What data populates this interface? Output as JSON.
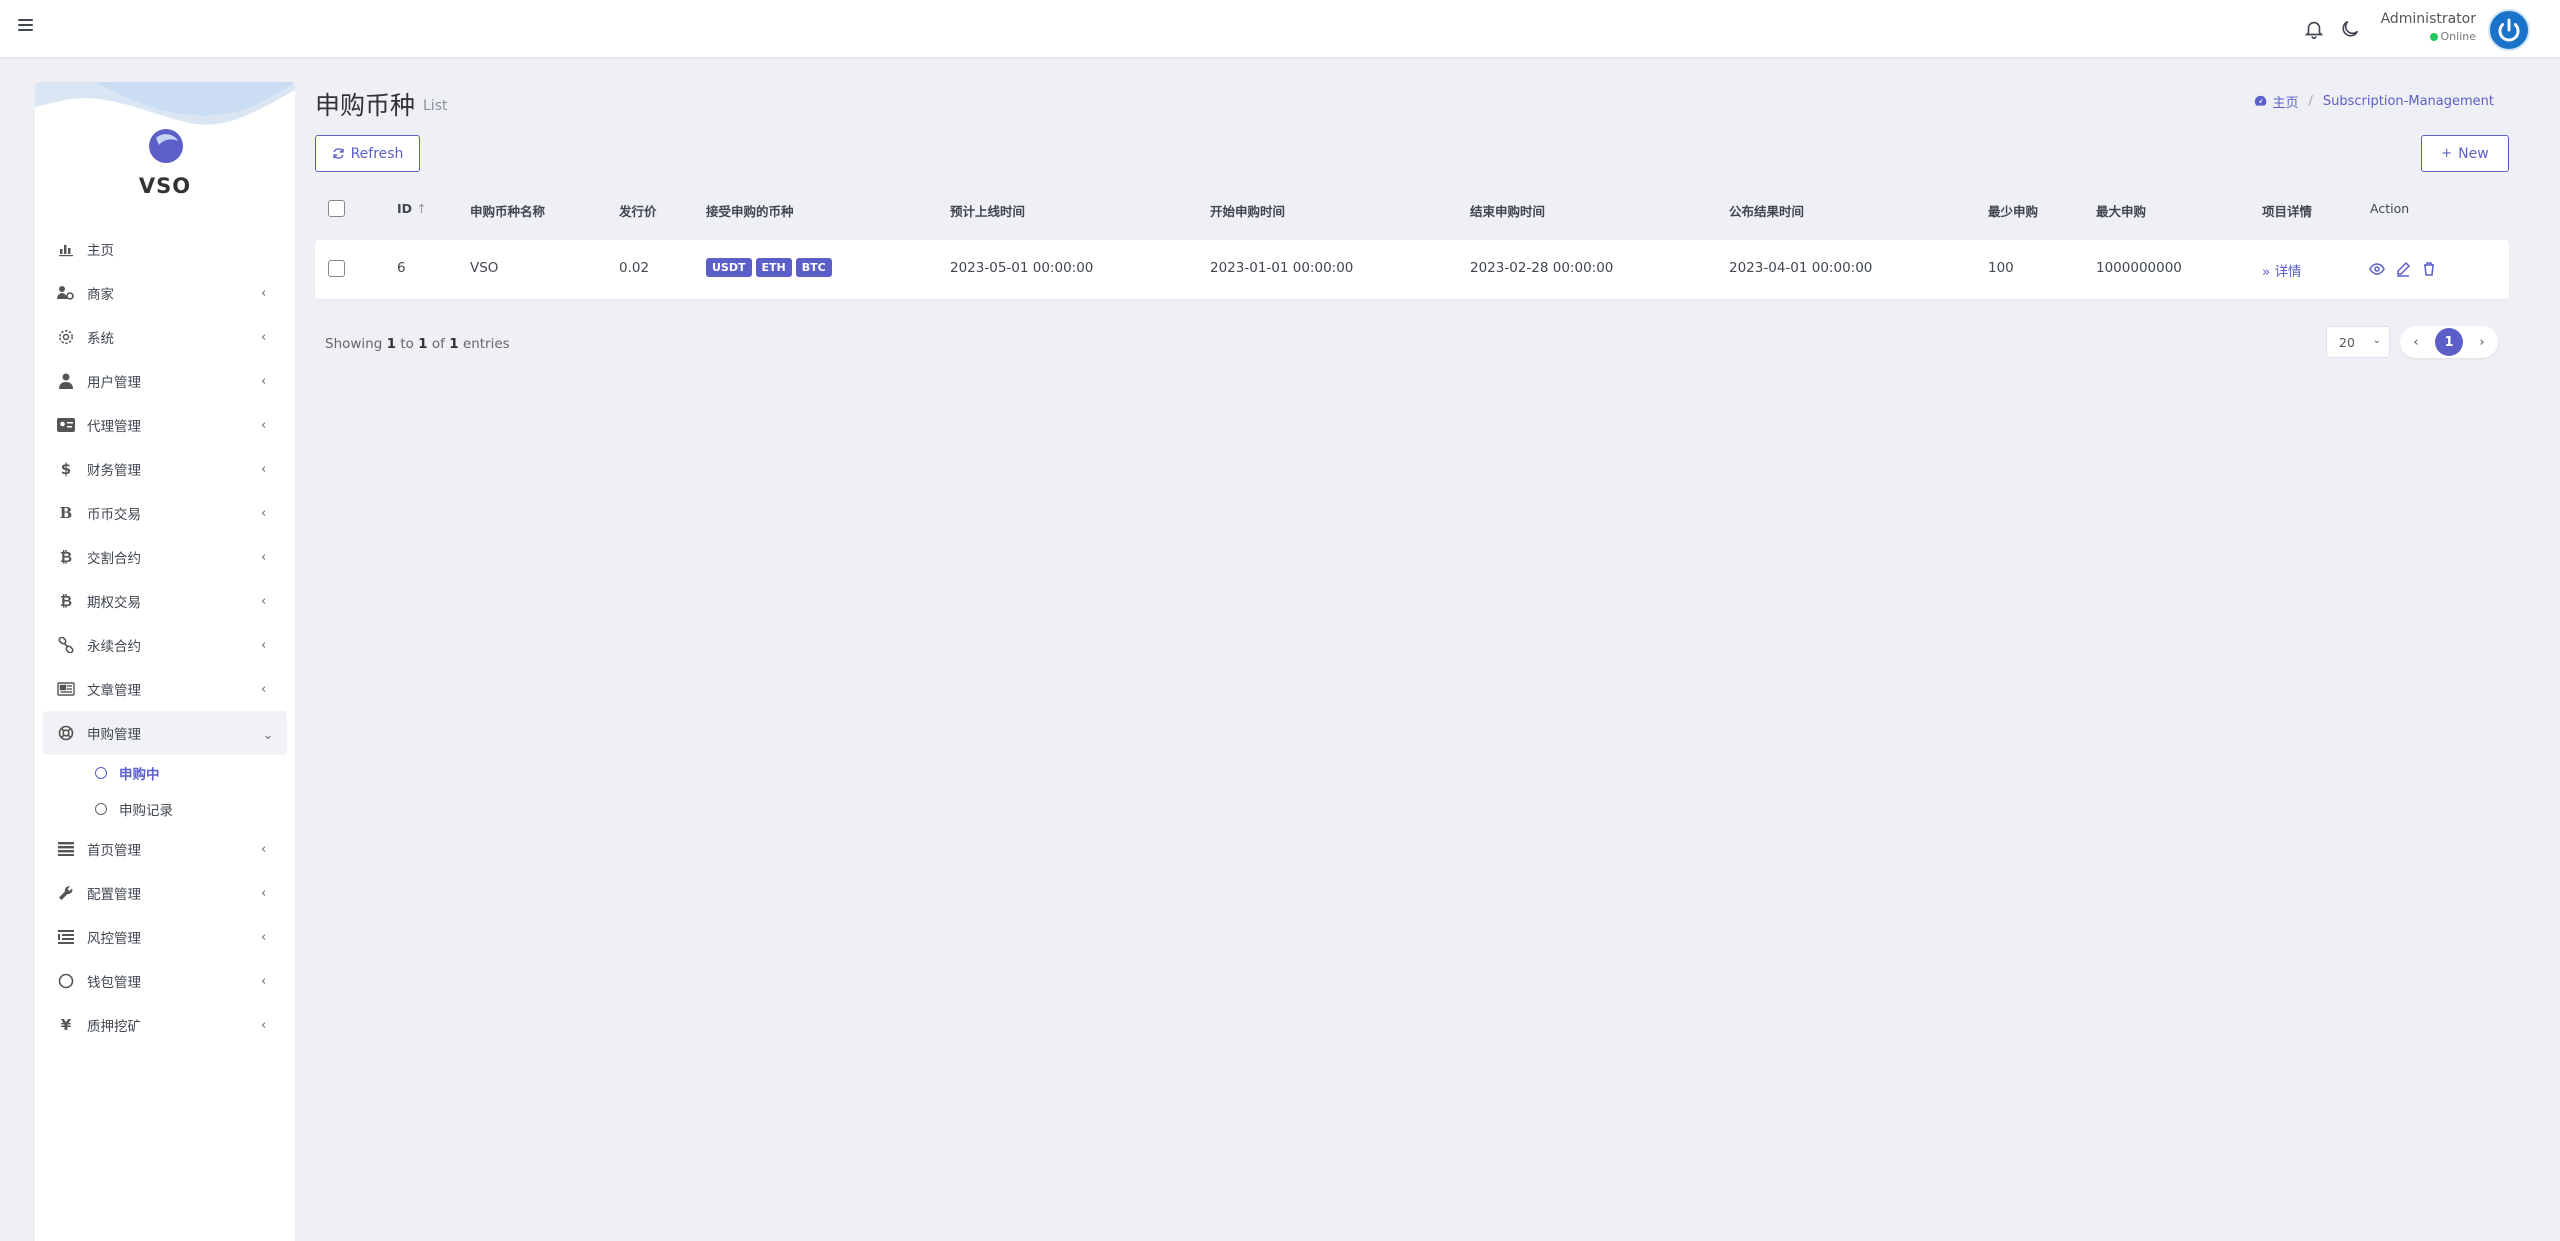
{
  "topbar": {
    "user_name": "Administrator",
    "user_status": "Online"
  },
  "sidebar": {
    "brand": "VSO",
    "items": [
      {
        "label": "主页",
        "icon": "chart-bar-icon",
        "has_chevron": false
      },
      {
        "label": "商家",
        "icon": "users-cog-icon",
        "has_chevron": true
      },
      {
        "label": "系统",
        "icon": "gear-icon",
        "has_chevron": true
      },
      {
        "label": "用户管理",
        "icon": "user-tie-icon",
        "has_chevron": true
      },
      {
        "label": "代理管理",
        "icon": "id-card-icon",
        "has_chevron": true
      },
      {
        "label": "财务管理",
        "icon": "dollar-icon",
        "has_chevron": true
      },
      {
        "label": "币币交易",
        "icon": "bitcoin-b-icon",
        "has_chevron": true
      },
      {
        "label": "交割合约",
        "icon": "bitcoin-icon",
        "has_chevron": true
      },
      {
        "label": "期权交易",
        "icon": "bitcoin-icon",
        "has_chevron": true
      },
      {
        "label": "永续合约",
        "icon": "link-icon",
        "has_chevron": true
      },
      {
        "label": "文章管理",
        "icon": "newspaper-icon",
        "has_chevron": true
      },
      {
        "label": "申购管理",
        "icon": "life-ring-icon",
        "has_chevron": true,
        "expanded": true
      },
      {
        "label": "首页管理",
        "icon": "list-icon",
        "has_chevron": true
      },
      {
        "label": "配置管理",
        "icon": "wrench-icon",
        "has_chevron": true
      },
      {
        "label": "风控管理",
        "icon": "list-alt-icon",
        "has_chevron": true
      },
      {
        "label": "钱包管理",
        "icon": "circle-icon",
        "has_chevron": true
      },
      {
        "label": "质押挖矿",
        "icon": "yen-icon",
        "has_chevron": true
      }
    ],
    "sub_items": [
      {
        "label": "申购中",
        "active": true
      },
      {
        "label": "申购记录",
        "active": false
      }
    ]
  },
  "page": {
    "title": "申购币种",
    "subtitle": "List"
  },
  "breadcrumb": {
    "home": "主页",
    "current": "Subscription-Management"
  },
  "toolbar": {
    "refresh_label": "Refresh",
    "new_label": "New"
  },
  "table": {
    "columns": [
      "ID",
      "申购币种名称",
      "发行价",
      "接受申购的币种",
      "预计上线时间",
      "开始申购时间",
      "结束申购时间",
      "公布结果时间",
      "最少申购",
      "最大申购",
      "项目详情",
      "Action"
    ],
    "rows": [
      {
        "id": "6",
        "name": "VSO",
        "price": "0.02",
        "accepted": [
          "USDT",
          "ETH",
          "BTC"
        ],
        "launch_time": "2023-05-01 00:00:00",
        "start_time": "2023-01-01 00:00:00",
        "end_time": "2023-02-28 00:00:00",
        "result_time": "2023-04-01 00:00:00",
        "min": "100",
        "max": "1000000000",
        "detail": "详情"
      }
    ]
  },
  "footer": {
    "showing": "Showing",
    "from": "1",
    "to_word": "to",
    "to": "1",
    "of_word": "of",
    "total": "1",
    "entries": "entries",
    "page_size": "20",
    "current_page": "1"
  },
  "colors": {
    "primary": "#5b5fc7",
    "background": "#eef0f6",
    "online": "#22c55e",
    "avatar": "#1a73c8"
  }
}
